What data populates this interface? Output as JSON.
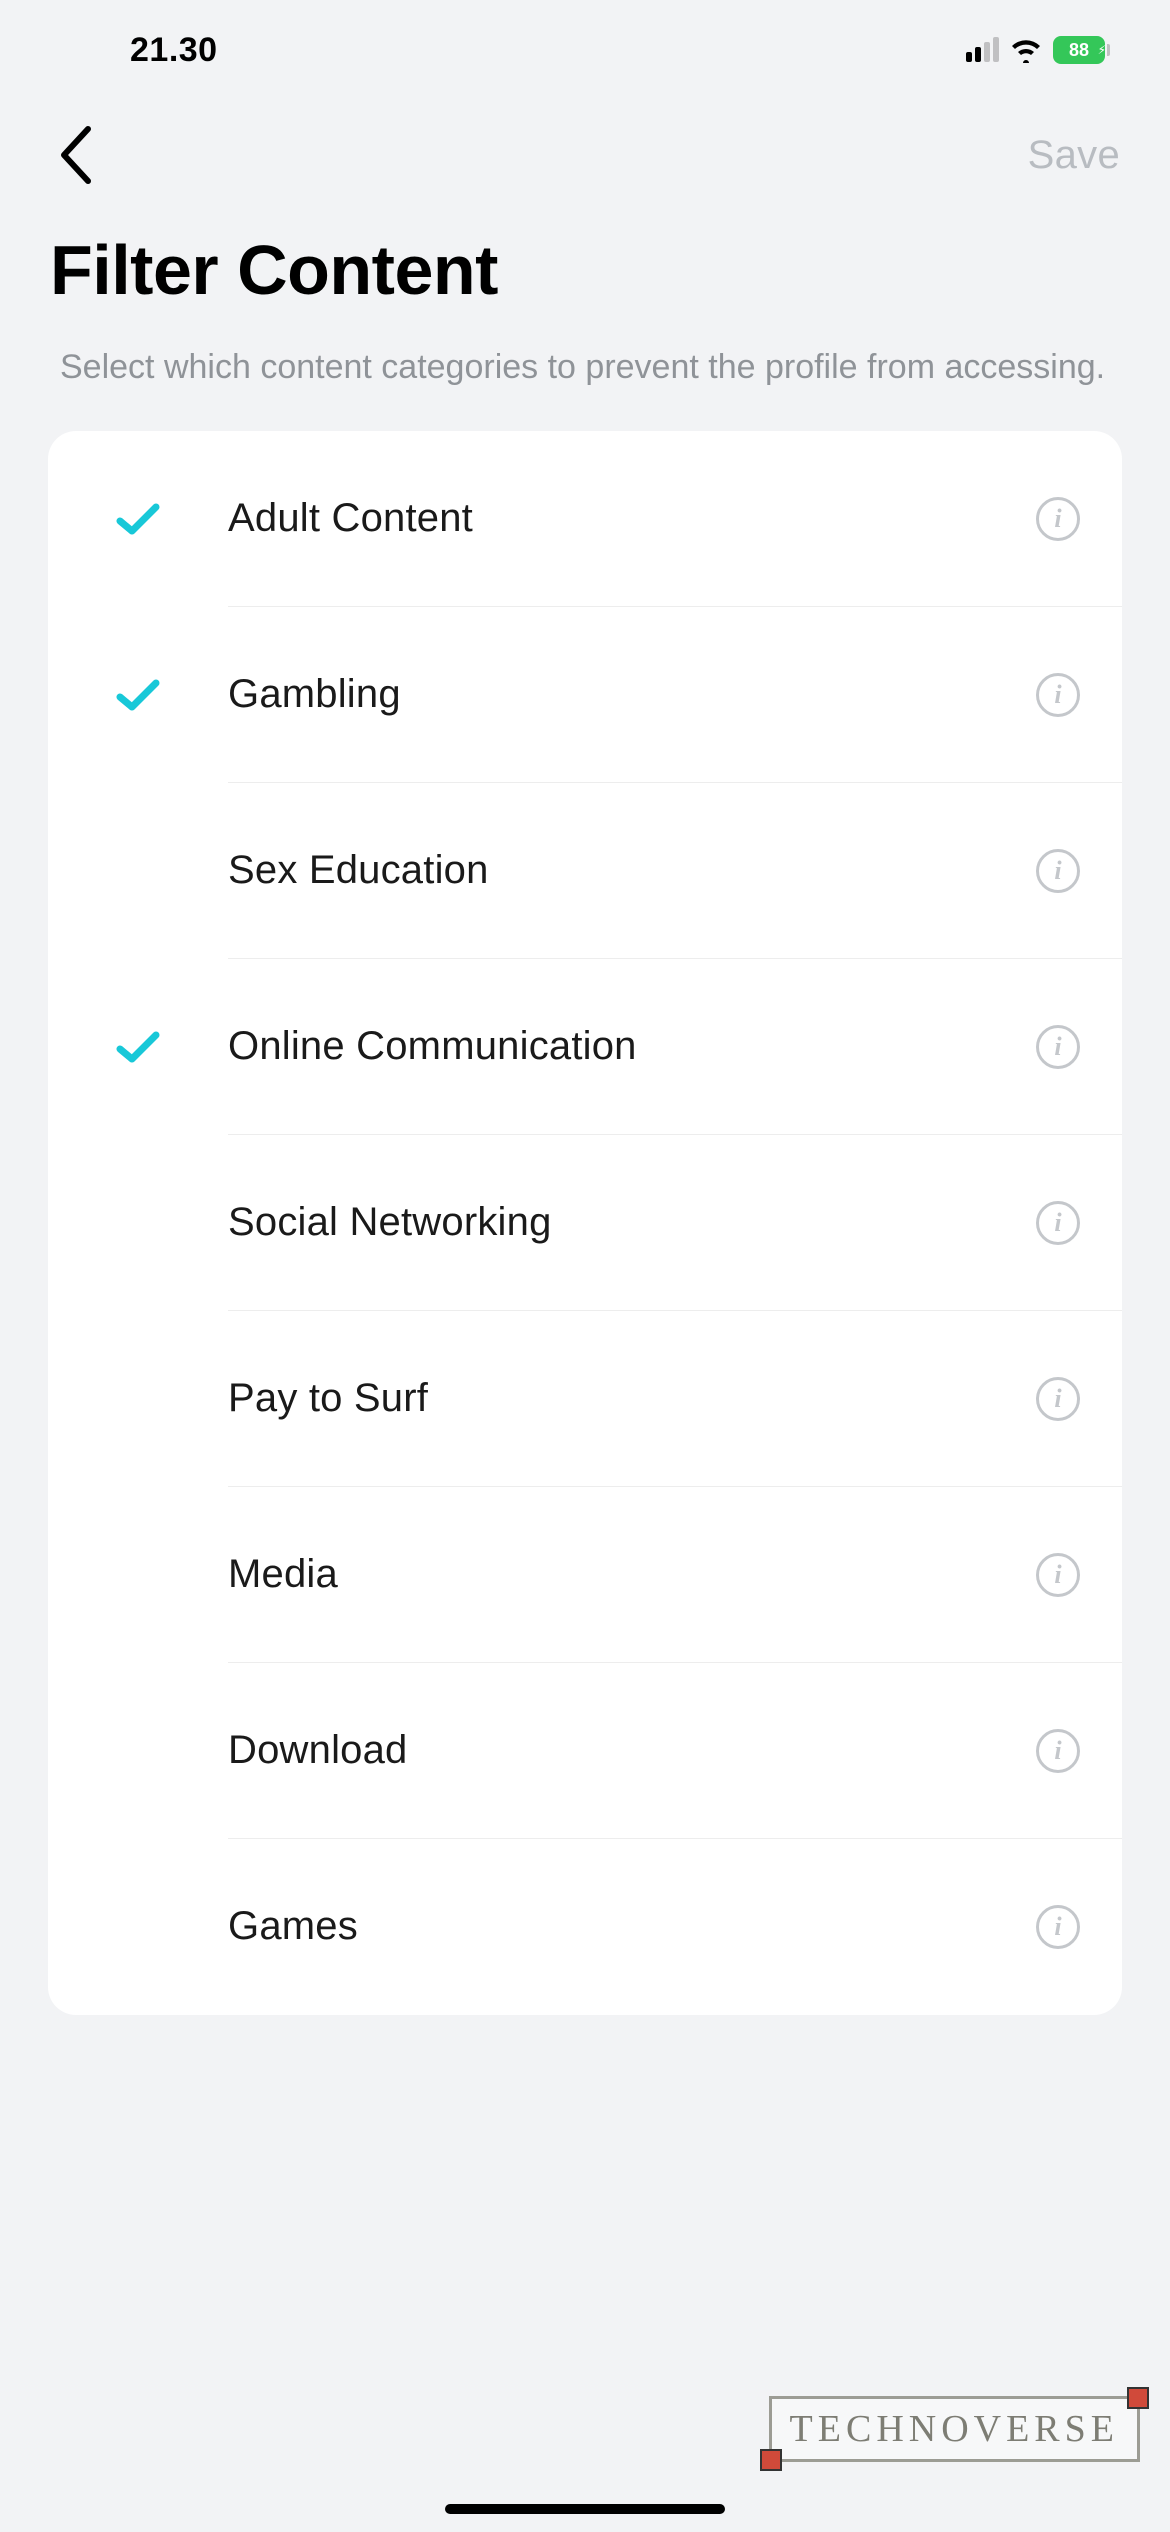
{
  "status_bar": {
    "time": "21.30",
    "battery_pct": "88"
  },
  "nav": {
    "save_label": "Save"
  },
  "header": {
    "title": "Filter Content",
    "subtitle": "Select which content categories to prevent the profile from accessing."
  },
  "categories": [
    {
      "label": "Adult Content",
      "checked": true
    },
    {
      "label": "Gambling",
      "checked": true
    },
    {
      "label": "Sex Education",
      "checked": false
    },
    {
      "label": "Online Communication",
      "checked": true
    },
    {
      "label": "Social Networking",
      "checked": false
    },
    {
      "label": "Pay to Surf",
      "checked": false
    },
    {
      "label": "Media",
      "checked": false
    },
    {
      "label": "Download",
      "checked": false
    },
    {
      "label": "Games",
      "checked": false
    }
  ],
  "watermark": {
    "text": "TECHNOVERSE"
  },
  "colors": {
    "check": "#18c8d8",
    "info_border": "#c4c7cb",
    "bg": "#f2f3f5"
  }
}
